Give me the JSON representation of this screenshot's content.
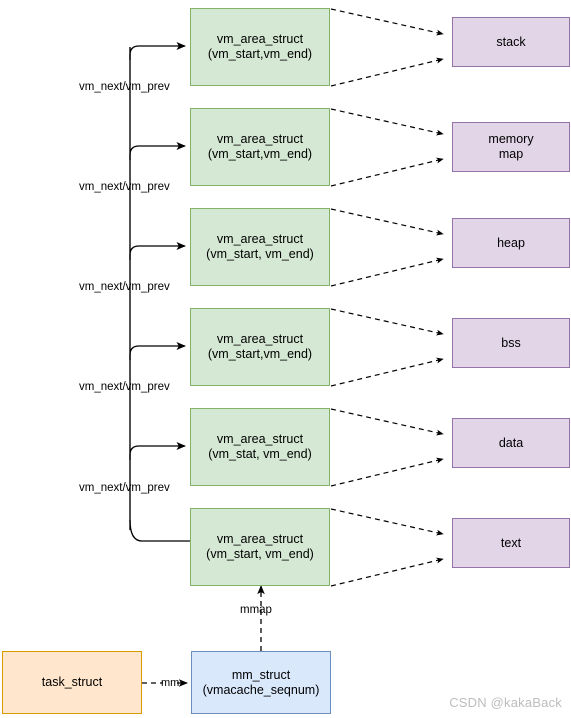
{
  "diagram": {
    "title": "Linux process virtual memory areas (vm_area_struct) diagram",
    "colors": {
      "vma_fill": "#d5e8d4",
      "vma_stroke": "#82b366",
      "segment_fill": "#e1d5e7",
      "segment_stroke": "#9673a6",
      "task_fill": "#ffe6cc",
      "task_stroke": "#d79b00",
      "mm_fill": "#dae8fc",
      "mm_stroke": "#6c8ebf",
      "line": "#000000",
      "watermark": "#bdbdbd",
      "background": "#ffffff"
    }
  },
  "vma_nodes": [
    {
      "title": "vm_area_struct",
      "fields": "(vm_start,vm_end)"
    },
    {
      "title": "vm_area_struct",
      "fields": "(vm_start,vm_end)"
    },
    {
      "title": "vm_area_struct",
      "fields": "(vm_start, vm_end)"
    },
    {
      "title": "vm_area_struct",
      "fields": "(vm_start,vm_end)"
    },
    {
      "title": "vm_area_struct",
      "fields": "(vm_stat, vm_end)"
    },
    {
      "title": "vm_area_struct",
      "fields": "(vm_start, vm_end)"
    }
  ],
  "segment_nodes": [
    {
      "label": "stack"
    },
    {
      "label": "memory\nmap",
      "line1": "memory",
      "line2": "map"
    },
    {
      "label": "heap"
    },
    {
      "label": "bss"
    },
    {
      "label": "data"
    },
    {
      "label": "text"
    }
  ],
  "link_labels": [
    "vm_next/vm_prev",
    "vm_next/vm_prev",
    "vm_next/vm_prev",
    "vm_next/vm_prev",
    "vm_next/vm_prev"
  ],
  "mmap_label": "mmap",
  "mm_label": "mm",
  "task_struct": {
    "title": "task_struct"
  },
  "mm_struct": {
    "title": "mm_struct",
    "fields": "(vmacache_seqnum)"
  },
  "watermark": "CSDN @kakaBack"
}
